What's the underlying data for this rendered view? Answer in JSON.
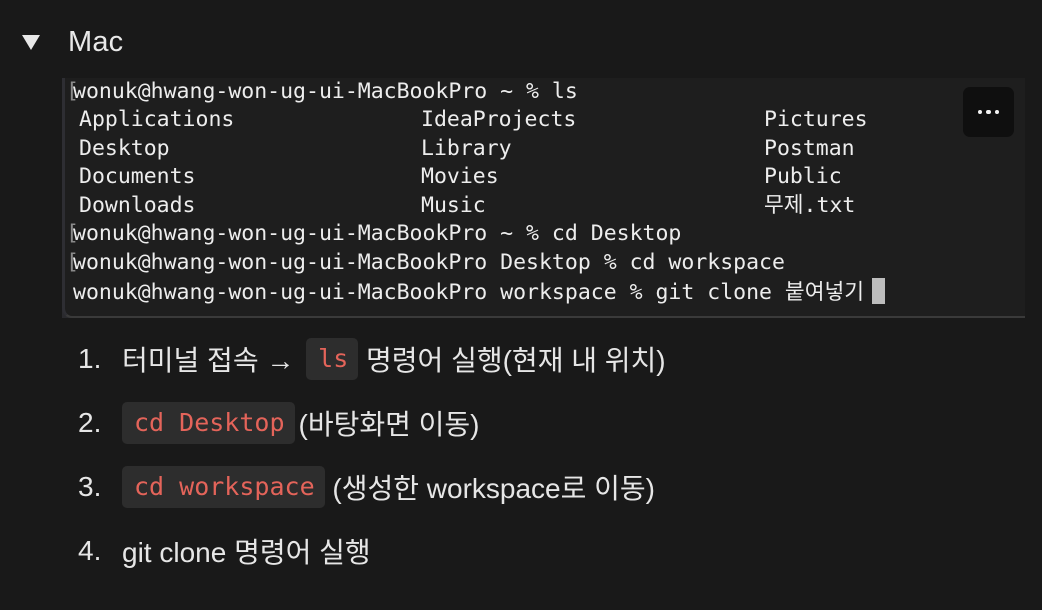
{
  "toggle": {
    "title": "Mac"
  },
  "terminal": {
    "prompt_lines": [
      "wonuk@hwang-won-ug-ui-MacBookPro ~ % ls",
      "wonuk@hwang-won-ug-ui-MacBookPro ~ % cd Desktop",
      "wonuk@hwang-won-ug-ui-MacBookPro Desktop % cd workspace",
      "wonuk@hwang-won-ug-ui-MacBookPro workspace % git clone 붙여넣기"
    ],
    "ls_columns": [
      [
        "Applications",
        "Desktop",
        "Documents",
        "Downloads"
      ],
      [
        "IdeaProjects",
        "Library",
        "Movies",
        "Music"
      ],
      [
        "Pictures",
        "Postman",
        "Public",
        "무제.txt"
      ]
    ],
    "more_icon": "more-horizontal-icon"
  },
  "steps": [
    {
      "num": "1.",
      "before": "터미널 접속 → ",
      "code": "ls",
      "after": " 명령어 실행(현재 내 위치)"
    },
    {
      "num": "2.",
      "before": "",
      "code": "cd Desktop",
      "after": "(바탕화면 이동)"
    },
    {
      "num": "3.",
      "before": "",
      "code": "cd workspace",
      "after": " (생성한 workspace로 이동)"
    },
    {
      "num": "4.",
      "before": "git clone 명령어 실행",
      "code": "",
      "after": ""
    }
  ],
  "colors": {
    "background": "#191919",
    "code_text": "#e4645a",
    "code_bg": "#2d2d2d"
  }
}
